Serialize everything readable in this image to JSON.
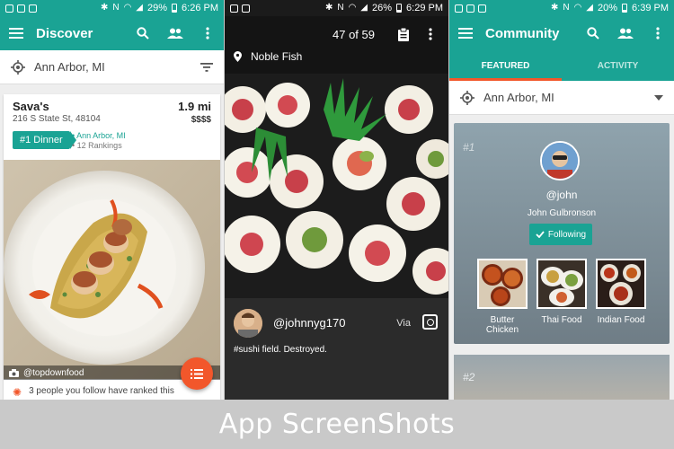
{
  "caption": "App ScreenShots",
  "colors": {
    "primary": "#1aa394",
    "accent": "#f2572b",
    "dark": "#141414"
  },
  "screen1": {
    "status": {
      "battery": "29%",
      "time": "6:26 PM"
    },
    "title": "Discover",
    "location": "Ann Arbor, MI",
    "card": {
      "name": "Sava's",
      "address": "216 S State St, 48104",
      "distance": "1.9 mi",
      "price": "$$$$",
      "rank_badge": "#1 Dinner",
      "rank_city": "Ann Arbor, MI",
      "rank_count": "12 Rankings",
      "photo_credit": "@topdownfood",
      "activity": "3 people you follow have ranked this"
    },
    "icons": [
      "menu-icon",
      "search-icon",
      "people-icon",
      "more-vert-icon",
      "location-target-icon",
      "filter-icon",
      "camera-icon",
      "list-icon"
    ]
  },
  "screen2": {
    "status": {
      "battery": "26%",
      "time": "6:29 PM"
    },
    "counter": "47 of 59",
    "venue": "Noble Fish",
    "user": "@johnnyg170",
    "via": "Via",
    "caption": "#sushi field. Destroyed."
  },
  "screen3": {
    "status": {
      "battery": "20%",
      "time": "6:39 PM"
    },
    "title": "Community",
    "tabs": [
      "FEATURED",
      "ACTIVITY"
    ],
    "location": "Ann Arbor, MI",
    "user": {
      "rank": "#1",
      "handle": "@john",
      "name": "John Gulbronson",
      "follow_label": "Following",
      "favorites": [
        "Butter Chicken",
        "Thai Food",
        "Indian Food"
      ]
    },
    "next_rank": "#2"
  }
}
